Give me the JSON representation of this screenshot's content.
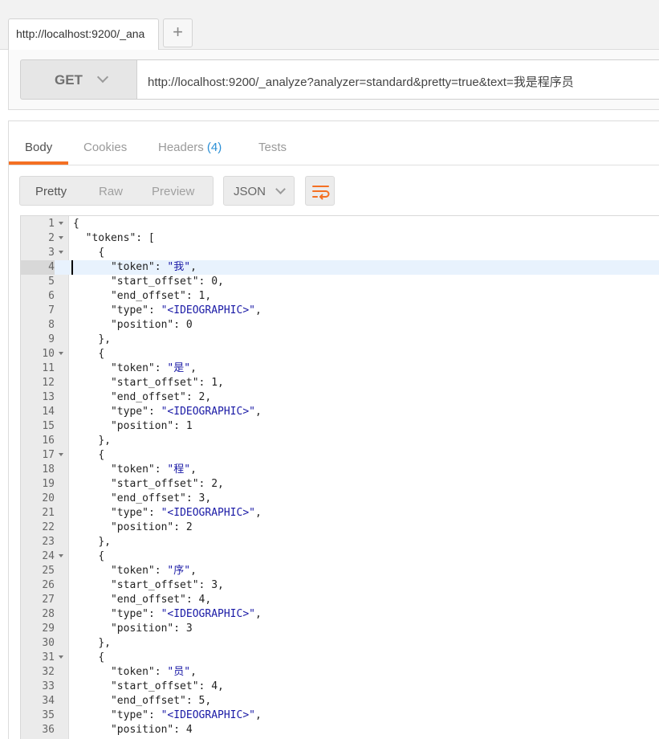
{
  "tab": {
    "url": "http://localhost:9200/_ana",
    "add_label": "+"
  },
  "request": {
    "method": "GET",
    "url": "http://localhost:9200/_analyze?analyzer=standard&pretty=true&text=我是程序员"
  },
  "response": {
    "tabs": {
      "body": "Body",
      "cookies": "Cookies",
      "headers": "Headers",
      "headers_count": "(4)",
      "tests": "Tests"
    },
    "view_modes": {
      "pretty": "Pretty",
      "raw": "Raw",
      "preview": "Preview"
    },
    "format": "JSON",
    "editor": {
      "lines": [
        {
          "n": "1",
          "fold": true,
          "indent": 0,
          "parts": [
            [
              "p",
              "{"
            ]
          ]
        },
        {
          "n": "2",
          "fold": true,
          "indent": 1,
          "parts": [
            [
              "k",
              "\"tokens\""
            ],
            [
              "p",
              ": ["
            ]
          ]
        },
        {
          "n": "3",
          "fold": true,
          "indent": 2,
          "parts": [
            [
              "p",
              "{"
            ]
          ]
        },
        {
          "n": "4",
          "fold": false,
          "indent": 3,
          "hl": true,
          "parts": [
            [
              "k",
              "\"token\""
            ],
            [
              "p",
              ": "
            ],
            [
              "s",
              "\"我\""
            ],
            [
              "p",
              ","
            ]
          ]
        },
        {
          "n": "5",
          "fold": false,
          "indent": 3,
          "parts": [
            [
              "k",
              "\"start_offset\""
            ],
            [
              "p",
              ": "
            ],
            [
              "n",
              "0"
            ],
            [
              "p",
              ","
            ]
          ]
        },
        {
          "n": "6",
          "fold": false,
          "indent": 3,
          "parts": [
            [
              "k",
              "\"end_offset\""
            ],
            [
              "p",
              ": "
            ],
            [
              "n",
              "1"
            ],
            [
              "p",
              ","
            ]
          ]
        },
        {
          "n": "7",
          "fold": false,
          "indent": 3,
          "parts": [
            [
              "k",
              "\"type\""
            ],
            [
              "p",
              ": "
            ],
            [
              "s",
              "\"<IDEOGRAPHIC>\""
            ],
            [
              "p",
              ","
            ]
          ]
        },
        {
          "n": "8",
          "fold": false,
          "indent": 3,
          "parts": [
            [
              "k",
              "\"position\""
            ],
            [
              "p",
              ": "
            ],
            [
              "n",
              "0"
            ]
          ]
        },
        {
          "n": "9",
          "fold": false,
          "indent": 2,
          "parts": [
            [
              "p",
              "},"
            ]
          ]
        },
        {
          "n": "10",
          "fold": true,
          "indent": 2,
          "parts": [
            [
              "p",
              "{"
            ]
          ]
        },
        {
          "n": "11",
          "fold": false,
          "indent": 3,
          "parts": [
            [
              "k",
              "\"token\""
            ],
            [
              "p",
              ": "
            ],
            [
              "s",
              "\"是\""
            ],
            [
              "p",
              ","
            ]
          ]
        },
        {
          "n": "12",
          "fold": false,
          "indent": 3,
          "parts": [
            [
              "k",
              "\"start_offset\""
            ],
            [
              "p",
              ": "
            ],
            [
              "n",
              "1"
            ],
            [
              "p",
              ","
            ]
          ]
        },
        {
          "n": "13",
          "fold": false,
          "indent": 3,
          "parts": [
            [
              "k",
              "\"end_offset\""
            ],
            [
              "p",
              ": "
            ],
            [
              "n",
              "2"
            ],
            [
              "p",
              ","
            ]
          ]
        },
        {
          "n": "14",
          "fold": false,
          "indent": 3,
          "parts": [
            [
              "k",
              "\"type\""
            ],
            [
              "p",
              ": "
            ],
            [
              "s",
              "\"<IDEOGRAPHIC>\""
            ],
            [
              "p",
              ","
            ]
          ]
        },
        {
          "n": "15",
          "fold": false,
          "indent": 3,
          "parts": [
            [
              "k",
              "\"position\""
            ],
            [
              "p",
              ": "
            ],
            [
              "n",
              "1"
            ]
          ]
        },
        {
          "n": "16",
          "fold": false,
          "indent": 2,
          "parts": [
            [
              "p",
              "},"
            ]
          ]
        },
        {
          "n": "17",
          "fold": true,
          "indent": 2,
          "parts": [
            [
              "p",
              "{"
            ]
          ]
        },
        {
          "n": "18",
          "fold": false,
          "indent": 3,
          "parts": [
            [
              "k",
              "\"token\""
            ],
            [
              "p",
              ": "
            ],
            [
              "s",
              "\"程\""
            ],
            [
              "p",
              ","
            ]
          ]
        },
        {
          "n": "19",
          "fold": false,
          "indent": 3,
          "parts": [
            [
              "k",
              "\"start_offset\""
            ],
            [
              "p",
              ": "
            ],
            [
              "n",
              "2"
            ],
            [
              "p",
              ","
            ]
          ]
        },
        {
          "n": "20",
          "fold": false,
          "indent": 3,
          "parts": [
            [
              "k",
              "\"end_offset\""
            ],
            [
              "p",
              ": "
            ],
            [
              "n",
              "3"
            ],
            [
              "p",
              ","
            ]
          ]
        },
        {
          "n": "21",
          "fold": false,
          "indent": 3,
          "parts": [
            [
              "k",
              "\"type\""
            ],
            [
              "p",
              ": "
            ],
            [
              "s",
              "\"<IDEOGRAPHIC>\""
            ],
            [
              "p",
              ","
            ]
          ]
        },
        {
          "n": "22",
          "fold": false,
          "indent": 3,
          "parts": [
            [
              "k",
              "\"position\""
            ],
            [
              "p",
              ": "
            ],
            [
              "n",
              "2"
            ]
          ]
        },
        {
          "n": "23",
          "fold": false,
          "indent": 2,
          "parts": [
            [
              "p",
              "},"
            ]
          ]
        },
        {
          "n": "24",
          "fold": true,
          "indent": 2,
          "parts": [
            [
              "p",
              "{"
            ]
          ]
        },
        {
          "n": "25",
          "fold": false,
          "indent": 3,
          "parts": [
            [
              "k",
              "\"token\""
            ],
            [
              "p",
              ": "
            ],
            [
              "s",
              "\"序\""
            ],
            [
              "p",
              ","
            ]
          ]
        },
        {
          "n": "26",
          "fold": false,
          "indent": 3,
          "parts": [
            [
              "k",
              "\"start_offset\""
            ],
            [
              "p",
              ": "
            ],
            [
              "n",
              "3"
            ],
            [
              "p",
              ","
            ]
          ]
        },
        {
          "n": "27",
          "fold": false,
          "indent": 3,
          "parts": [
            [
              "k",
              "\"end_offset\""
            ],
            [
              "p",
              ": "
            ],
            [
              "n",
              "4"
            ],
            [
              "p",
              ","
            ]
          ]
        },
        {
          "n": "28",
          "fold": false,
          "indent": 3,
          "parts": [
            [
              "k",
              "\"type\""
            ],
            [
              "p",
              ": "
            ],
            [
              "s",
              "\"<IDEOGRAPHIC>\""
            ],
            [
              "p",
              ","
            ]
          ]
        },
        {
          "n": "29",
          "fold": false,
          "indent": 3,
          "parts": [
            [
              "k",
              "\"position\""
            ],
            [
              "p",
              ": "
            ],
            [
              "n",
              "3"
            ]
          ]
        },
        {
          "n": "30",
          "fold": false,
          "indent": 2,
          "parts": [
            [
              "p",
              "},"
            ]
          ]
        },
        {
          "n": "31",
          "fold": true,
          "indent": 2,
          "parts": [
            [
              "p",
              "{"
            ]
          ]
        },
        {
          "n": "32",
          "fold": false,
          "indent": 3,
          "parts": [
            [
              "k",
              "\"token\""
            ],
            [
              "p",
              ": "
            ],
            [
              "s",
              "\"员\""
            ],
            [
              "p",
              ","
            ]
          ]
        },
        {
          "n": "33",
          "fold": false,
          "indent": 3,
          "parts": [
            [
              "k",
              "\"start_offset\""
            ],
            [
              "p",
              ": "
            ],
            [
              "n",
              "4"
            ],
            [
              "p",
              ","
            ]
          ]
        },
        {
          "n": "34",
          "fold": false,
          "indent": 3,
          "parts": [
            [
              "k",
              "\"end_offset\""
            ],
            [
              "p",
              ": "
            ],
            [
              "n",
              "5"
            ],
            [
              "p",
              ","
            ]
          ]
        },
        {
          "n": "35",
          "fold": false,
          "indent": 3,
          "parts": [
            [
              "k",
              "\"type\""
            ],
            [
              "p",
              ": "
            ],
            [
              "s",
              "\"<IDEOGRAPHIC>\""
            ],
            [
              "p",
              ","
            ]
          ]
        },
        {
          "n": "36",
          "fold": false,
          "indent": 3,
          "parts": [
            [
              "k",
              "\"position\""
            ],
            [
              "p",
              ": "
            ],
            [
              "n",
              "4"
            ]
          ]
        }
      ]
    }
  },
  "colors": {
    "accent": "#f47023",
    "count": "#2a8fd6",
    "string": "#1a1aa6"
  }
}
